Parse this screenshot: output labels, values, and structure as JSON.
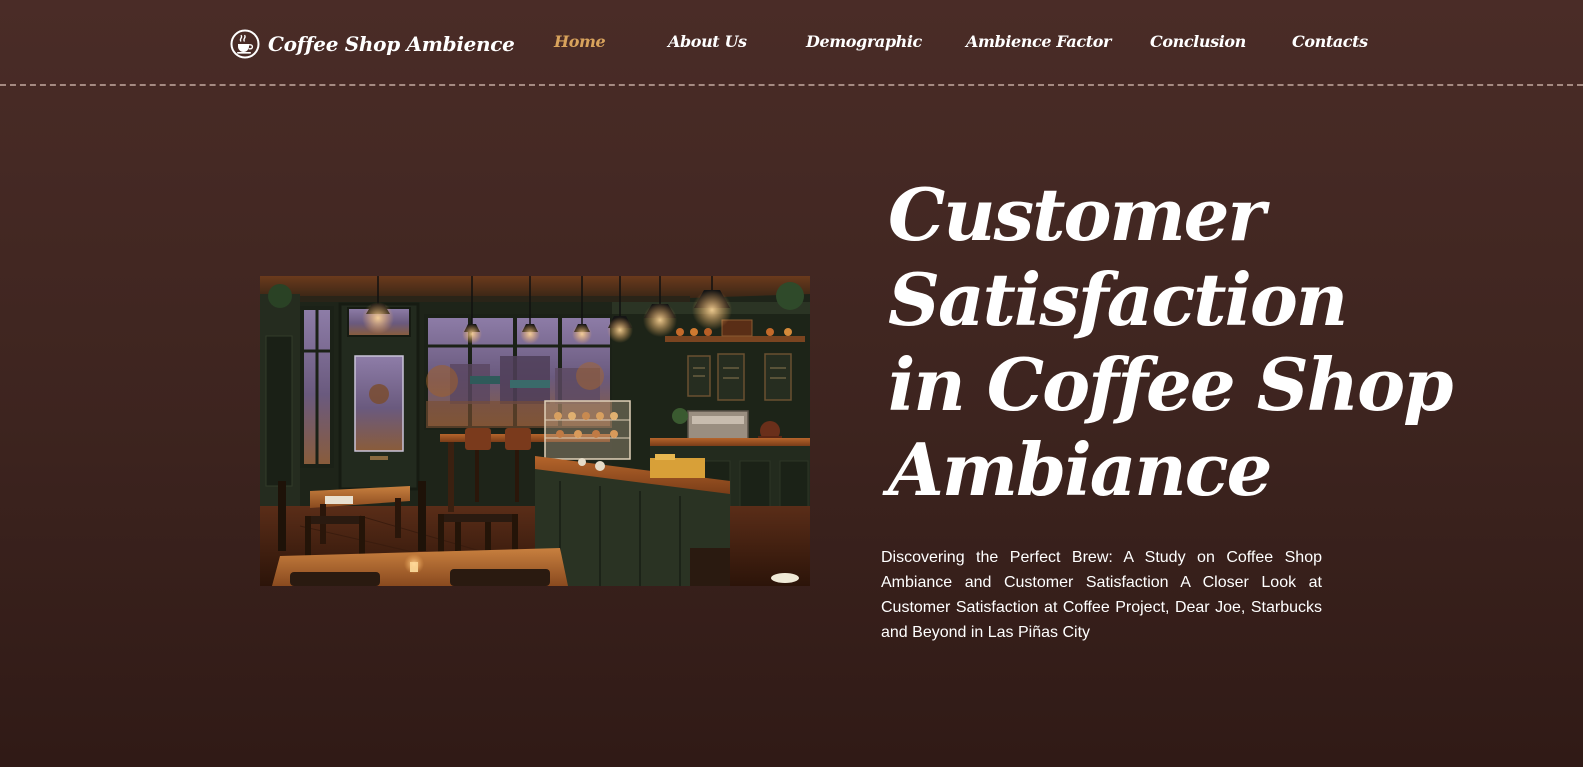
{
  "brand": {
    "name": "Coffee Shop Ambience",
    "logo_icon": "coffee-cup-icon"
  },
  "nav": {
    "items": [
      {
        "label": "Home",
        "active": true
      },
      {
        "label": "About Us",
        "active": false
      },
      {
        "label": "Demographic",
        "active": false
      },
      {
        "label": "Ambience Factor",
        "active": false
      },
      {
        "label": "Conclusion",
        "active": false
      },
      {
        "label": "Contacts",
        "active": false
      }
    ]
  },
  "hero": {
    "title_lines": [
      "Customer",
      "Satisfaction",
      "in Coffee Shop",
      "Ambiance"
    ],
    "description": "Discovering the Perfect Brew: A Study on Coffee Shop Ambiance and Customer Satisfaction A Closer Look at Customer Satisfaction at Coffee Project, Dear Joe, Starbucks and Beyond in Las Piñas City"
  },
  "colors": {
    "background_top": "#4a2c27",
    "background_bottom": "#301a16",
    "accent": "#d9a35c",
    "text": "#ffffff",
    "divider": "#a58a82"
  }
}
